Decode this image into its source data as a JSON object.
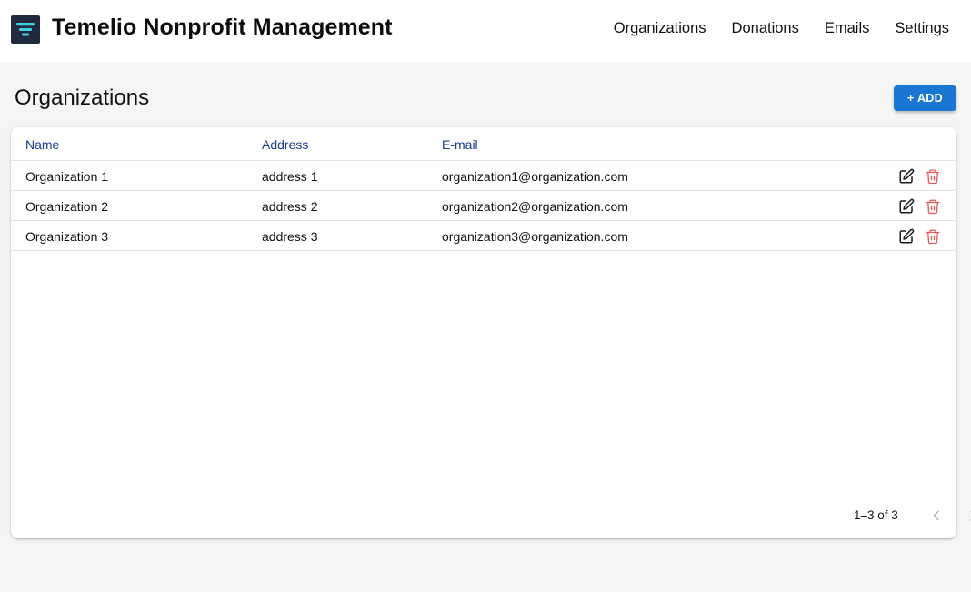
{
  "app": {
    "title": "Temelio Nonprofit Management"
  },
  "nav": {
    "items": [
      {
        "label": "Organizations"
      },
      {
        "label": "Donations"
      },
      {
        "label": "Emails"
      },
      {
        "label": "Settings"
      }
    ]
  },
  "page": {
    "title": "Organizations",
    "add_label": "+ ADD"
  },
  "table": {
    "columns": [
      "Name",
      "Address",
      "E-mail"
    ],
    "rows": [
      {
        "name": "Organization 1",
        "address": "address 1",
        "email": "organization1@organization.com"
      },
      {
        "name": "Organization 2",
        "address": "address 2",
        "email": "organization2@organization.com"
      },
      {
        "name": "Organization 3",
        "address": "address 3",
        "email": "organization3@organization.com"
      }
    ],
    "row_actions": [
      "edit-icon",
      "trash-icon"
    ]
  },
  "pagination": {
    "range_text": "1–3 of 3",
    "prev_icon": "chevron-left-icon",
    "next_icon": "chevron-right-icon"
  },
  "colors": {
    "primary": "#1976d2",
    "header_text": "#1a3a8f",
    "delete": "#e05c5c",
    "logo_bg": "#1f2a3c",
    "logo_accent": "#3fd0e0"
  }
}
